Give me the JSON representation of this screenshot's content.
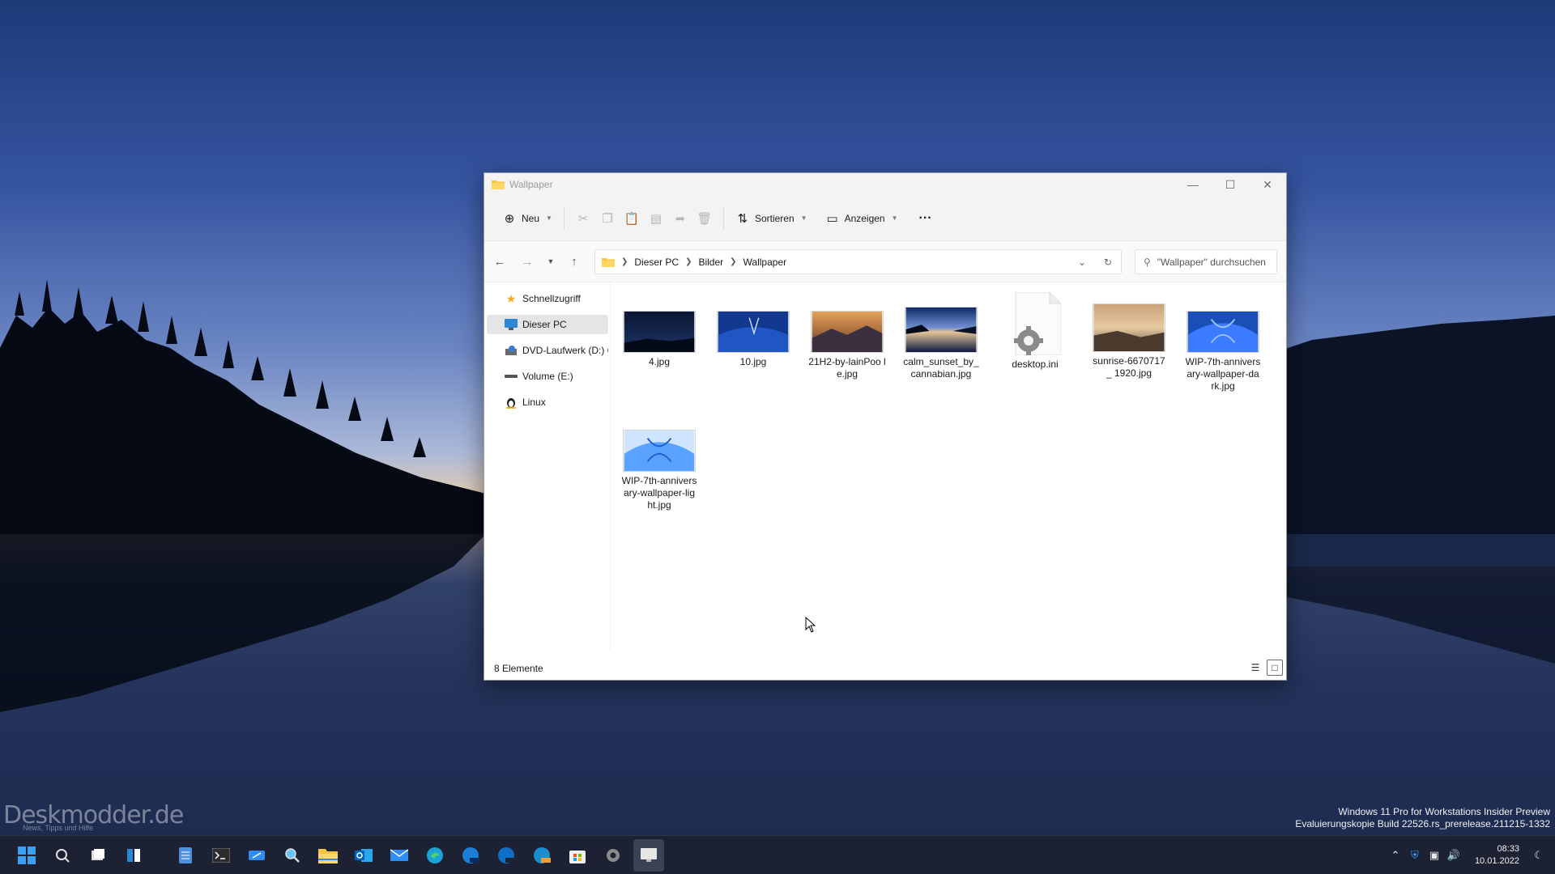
{
  "window": {
    "title": "Wallpaper",
    "toolbar": {
      "new_label": "Neu",
      "sort_label": "Sortieren",
      "view_label": "Anzeigen",
      "more_label": "···"
    },
    "breadcrumb": [
      "Dieser PC",
      "Bilder",
      "Wallpaper"
    ],
    "search_placeholder": "\"Wallpaper\" durchsuchen",
    "sidebar": [
      {
        "label": "Schnellzugriff",
        "icon": "star-icon"
      },
      {
        "label": "Dieser PC",
        "icon": "pc-icon",
        "selected": true
      },
      {
        "label": "DVD-Laufwerk (D:) C",
        "icon": "dvd-icon"
      },
      {
        "label": "Volume (E:)",
        "icon": "drive-icon"
      },
      {
        "label": "Linux",
        "icon": "linux-icon"
      }
    ],
    "files": [
      {
        "name": "4.jpg"
      },
      {
        "name": "10.jpg"
      },
      {
        "name": "21H2-by-lainPoo le.jpg"
      },
      {
        "name": "calm_sunset_by_ cannabian.jpg"
      },
      {
        "name": "desktop.ini"
      },
      {
        "name": "sunrise-6670717_ 1920.jpg"
      },
      {
        "name": "WIP-7th-annivers ary-wallpaper-da rk.jpg"
      },
      {
        "name": "WIP-7th-annivers ary-wallpaper-lig ht.jpg"
      }
    ],
    "status": "8 Elemente"
  },
  "desktop": {
    "watermark": "Deskmodder.de",
    "watermark_sub": "News, Tipps und Hilfe",
    "eval_line1": "Windows 11 Pro for Workstations Insider Preview",
    "eval_line2": "Evaluierungskopie Build 22526.rs_prerelease.211215-1332"
  },
  "taskbar": {
    "time": "08:33",
    "date": "10.01.2022"
  },
  "colors": {
    "accent": "#0078d4",
    "folder": "#f5c542",
    "taskbar": "#1c2233"
  }
}
